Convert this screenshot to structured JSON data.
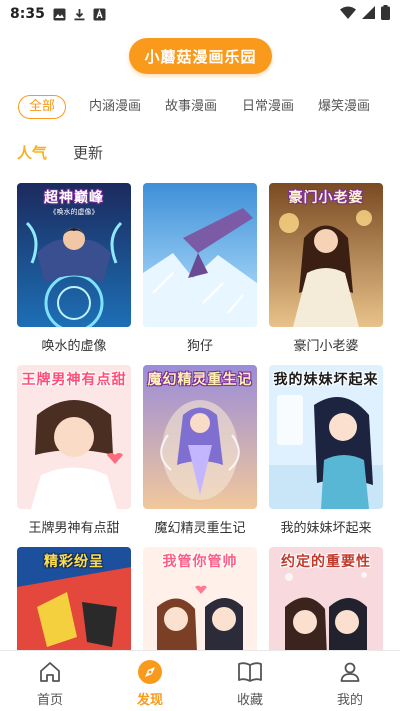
{
  "status": {
    "time": "8:35"
  },
  "header": {
    "title": "小蘑菇漫画乐园"
  },
  "categories": [
    "全部",
    "内涵漫画",
    "故事漫画",
    "日常漫画",
    "爆笑漫画"
  ],
  "subtabs": [
    "人气",
    "更新"
  ],
  "comics": [
    {
      "name": "唤水的虚像",
      "cover_title": "超神巅峰",
      "cover_sub": "《唤水的虚像》"
    },
    {
      "name": "狗仔",
      "cover_title": "",
      "cover_sub": ""
    },
    {
      "name": "豪门小老婆",
      "cover_title": "豪门小老婆",
      "cover_sub": ""
    },
    {
      "name": "王牌男神有点甜",
      "cover_title": "王牌男神有点甜",
      "cover_sub": ""
    },
    {
      "name": "魔幻精灵重生记",
      "cover_title": "魔幻精灵重生记",
      "cover_sub": ""
    },
    {
      "name": "我的妹妹坏起来",
      "cover_title": "我的妹妹坏起来",
      "cover_sub": ""
    },
    {
      "name": "",
      "cover_title": "精彩纷呈",
      "cover_sub": ""
    },
    {
      "name": "",
      "cover_title": "我管你管帅",
      "cover_sub": ""
    },
    {
      "name": "",
      "cover_title": "约定的重要性",
      "cover_sub": ""
    }
  ],
  "nav": [
    "首页",
    "发现",
    "收藏",
    "我的"
  ],
  "colors": {
    "accent": "#f99a1c",
    "subtab_active": "#f5b21e"
  }
}
